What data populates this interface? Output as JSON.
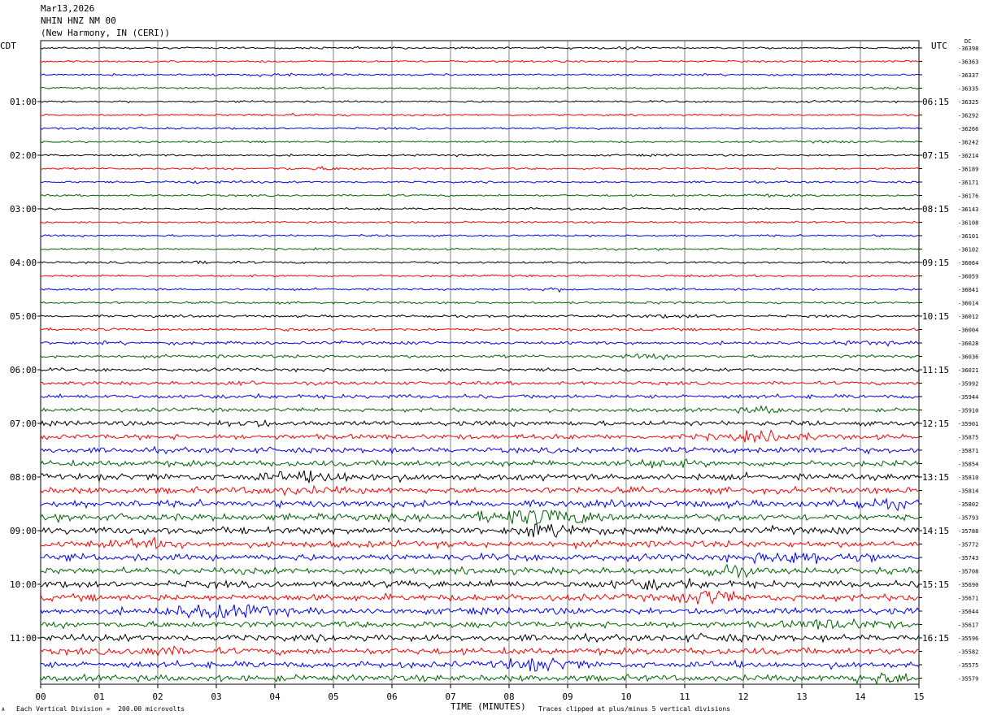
{
  "header": {
    "date": "Mar13,2026",
    "station": "NHIN HNZ NM 00",
    "location": "(New Harmony, IN (CERI))"
  },
  "left_axis_label": "CDT",
  "right_axis_label": "UTC",
  "dc_label": "DC",
  "footer": {
    "scale_note": "Each Vertical Division =  200.00 microvolts",
    "clip_note": "Traces clipped at plus/minus 5 vertical divisions",
    "corner_mark": "A"
  },
  "colors": [
    "#000000",
    "#ff0000",
    "#0000ff",
    "#006400"
  ],
  "chart_data": {
    "type": "line",
    "subtype": "helicorder",
    "xlabel": "TIME (MINUTES)",
    "x_ticks": [
      "00",
      "01",
      "02",
      "03",
      "04",
      "05",
      "06",
      "07",
      "08",
      "09",
      "10",
      "11",
      "12",
      "13",
      "14",
      "15"
    ],
    "xlim": [
      0,
      15
    ],
    "trace_minutes": 15,
    "traces_per_hour": 4,
    "left_time_labels": [
      "01:00",
      "02:00",
      "03:00",
      "04:00",
      "05:00",
      "06:00",
      "07:00",
      "08:00",
      "09:00",
      "10:00",
      "11:00"
    ],
    "right_time_labels": [
      "06:15",
      "07:15",
      "08:15",
      "09:15",
      "10:15",
      "11:15",
      "12:15",
      "13:15",
      "14:15",
      "15:15",
      "16:15"
    ],
    "dc_offsets": [
      "-36398",
      "-36363",
      "-36337",
      "-36335",
      "-36325",
      "-36292",
      "-36266",
      "-36242",
      "-36214",
      "-36189",
      "-36171",
      "-36176",
      "-36143",
      "-36108",
      "-36101",
      "-36102",
      "-36064",
      "-36059",
      "-36041",
      "-36014",
      "-36012",
      "-36004",
      "-36028",
      "-36036",
      "-36021",
      "-35992",
      "-35944",
      "-35910",
      "-35901",
      "-35875",
      "-35871",
      "-35854",
      "-35810",
      "-35814",
      "-35802",
      "-35793",
      "-35788",
      "-35772",
      "-35743",
      "-35708",
      "-35690",
      "-35671",
      "-35644",
      "-35617",
      "-35596",
      "-35582",
      "-35575",
      "-35579"
    ],
    "noise_amplitude_divisions": [
      0.5,
      0.5,
      0.5,
      0.5,
      0.5,
      0.5,
      0.5,
      0.5,
      0.5,
      0.5,
      0.5,
      0.5,
      0.5,
      0.5,
      0.5,
      0.5,
      0.55,
      0.55,
      0.55,
      0.55,
      0.6,
      0.7,
      0.8,
      0.8,
      0.8,
      0.9,
      1.0,
      1.0,
      1.2,
      1.3,
      1.4,
      1.5,
      1.6,
      1.6,
      1.7,
      1.8,
      1.8,
      1.7,
      1.7,
      1.7,
      1.7,
      1.7,
      1.7,
      1.6,
      1.7,
      1.7,
      1.6,
      1.6
    ],
    "clip_divisions": 5
  }
}
